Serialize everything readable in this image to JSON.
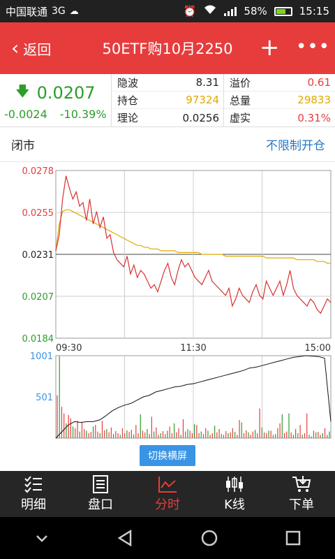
{
  "status_bar": {
    "carrier": "中国联通",
    "network": "3G",
    "net_small": "3G",
    "battery": "58%",
    "time": "15:15"
  },
  "header": {
    "back_label": "返回",
    "title": "50ETF购10月2250"
  },
  "quote": {
    "price": "0.0207",
    "change": "-0.0024",
    "change_pct": "-10.39%",
    "stats": [
      {
        "label": "隐波",
        "value": "8.31"
      },
      {
        "label": "溢价",
        "value": "0.61"
      },
      {
        "label": "持仓",
        "value": "97324"
      },
      {
        "label": "总量",
        "value": "29833"
      },
      {
        "label": "理论",
        "value": "0.0256"
      },
      {
        "label": "虚实",
        "value": "0.31%"
      }
    ]
  },
  "market": {
    "state": "闭市",
    "unlimited_label": "不限制开仓"
  },
  "chart_data": {
    "type": "line",
    "price_ticks": [
      "0.0278",
      "0.0255",
      "0.0231",
      "0.0207",
      "0.0184"
    ],
    "price_range": [
      0.0184,
      0.0278
    ],
    "prev_close": 0.0231,
    "time_labels": [
      "09:30",
      "11:30",
      "15:00"
    ],
    "volume_ticks": [
      "1001",
      "501"
    ],
    "volume_range": [
      0,
      1001
    ],
    "price_series": [
      0.0233,
      0.0242,
      0.0262,
      0.0275,
      0.0268,
      0.0262,
      0.0266,
      0.0258,
      0.026,
      0.025,
      0.0262,
      0.0248,
      0.0255,
      0.0246,
      0.0252,
      0.024,
      0.0242,
      0.0232,
      0.0228,
      0.0226,
      0.0224,
      0.023,
      0.022,
      0.0225,
      0.0218,
      0.0222,
      0.022,
      0.0216,
      0.0212,
      0.0214,
      0.021,
      0.0216,
      0.0222,
      0.0226,
      0.0218,
      0.0214,
      0.0222,
      0.0228,
      0.0224,
      0.0226,
      0.0222,
      0.0218,
      0.0216,
      0.0214,
      0.0218,
      0.0222,
      0.0216,
      0.0214,
      0.0212,
      0.021,
      0.0208,
      0.0212,
      0.0202,
      0.0206,
      0.0212,
      0.0208,
      0.0206,
      0.0204,
      0.021,
      0.0214,
      0.0208,
      0.0206,
      0.0216,
      0.0212,
      0.0208,
      0.0212,
      0.0216,
      0.0208,
      0.0214,
      0.0222,
      0.0212,
      0.0208,
      0.0206,
      0.0204,
      0.0202,
      0.0206,
      0.0204,
      0.02,
      0.0198,
      0.0202,
      0.0206,
      0.0204
    ],
    "avg_series": [
      0.0233,
      0.0248,
      0.0255,
      0.0256,
      0.0256,
      0.0255,
      0.0254,
      0.0253,
      0.0252,
      0.0251,
      0.025,
      0.0249,
      0.0248,
      0.0247,
      0.0246,
      0.0245,
      0.0244,
      0.0243,
      0.0242,
      0.0241,
      0.024,
      0.0239,
      0.0238,
      0.0237,
      0.0236,
      0.0236,
      0.0235,
      0.0235,
      0.0234,
      0.0234,
      0.0234,
      0.0233,
      0.0233,
      0.0233,
      0.0233,
      0.0233,
      0.0232,
      0.0232,
      0.0232,
      0.0232,
      0.0232,
      0.0232,
      0.0232,
      0.0231,
      0.0231,
      0.0231,
      0.0231,
      0.0231,
      0.0231,
      0.0231,
      0.023,
      0.023,
      0.023,
      0.023,
      0.023,
      0.023,
      0.023,
      0.023,
      0.023,
      0.023,
      0.023,
      0.023,
      0.0229,
      0.0229,
      0.0229,
      0.0229,
      0.0229,
      0.0229,
      0.0229,
      0.0229,
      0.0229,
      0.0228,
      0.0228,
      0.0228,
      0.0228,
      0.0228,
      0.0228,
      0.0227,
      0.0227,
      0.0227,
      0.0226,
      0.0226
    ],
    "volumes": [
      520,
      995,
      380,
      300,
      180,
      280,
      240,
      140,
      120,
      210,
      80,
      190,
      110,
      90,
      60,
      75,
      140,
      160,
      80,
      60,
      210,
      95,
      110,
      70,
      130,
      50,
      85,
      60,
      40,
      120,
      60,
      95,
      75,
      100,
      45,
      160,
      60,
      290,
      90,
      70,
      110,
      50,
      260,
      80,
      130,
      40,
      60,
      85,
      50,
      90,
      140,
      60,
      180,
      70,
      120,
      40,
      230,
      80,
      110,
      90,
      60,
      170,
      160,
      60,
      80,
      50,
      120,
      90,
      40,
      60,
      150,
      70,
      110,
      50,
      40,
      85,
      60,
      70,
      120,
      75,
      40,
      220,
      190,
      60,
      95,
      70,
      40,
      80,
      100,
      60,
      360,
      130,
      70,
      60,
      90,
      90,
      40,
      50,
      120,
      180,
      290,
      60,
      80,
      300,
      70,
      40,
      110,
      60,
      160,
      40,
      60,
      300,
      40,
      20,
      90,
      70,
      75,
      40,
      60,
      120,
      40,
      80
    ],
    "cum_volume": [
      0.0,
      0.08,
      0.16,
      0.2,
      0.19,
      0.2,
      0.2,
      0.22,
      0.27,
      0.33,
      0.37,
      0.4,
      0.42,
      0.46,
      0.5,
      0.52,
      0.56,
      0.58,
      0.6,
      0.62,
      0.63,
      0.65,
      0.66,
      0.68,
      0.7,
      0.72,
      0.74,
      0.76,
      0.78,
      0.8,
      0.82,
      0.85,
      0.86,
      0.88,
      0.9,
      0.92,
      0.94,
      0.96,
      0.98,
      0.99,
      1.0,
      0.995,
      0.99,
      0.97,
      0.2
    ]
  },
  "actions": {
    "switch_landscape": "切换横屏"
  },
  "bottom_nav": [
    {
      "label": "明细",
      "icon": "list-check-icon"
    },
    {
      "label": "盘口",
      "icon": "document-icon"
    },
    {
      "label": "分时",
      "icon": "line-chart-icon"
    },
    {
      "label": "K线",
      "icon": "candlestick-icon"
    },
    {
      "label": "下单",
      "icon": "cart-icon"
    }
  ],
  "colors": {
    "accent": "#e73c3c",
    "green": "#2a9d2a",
    "gold": "#e0a800",
    "blue": "#3a94e5"
  }
}
